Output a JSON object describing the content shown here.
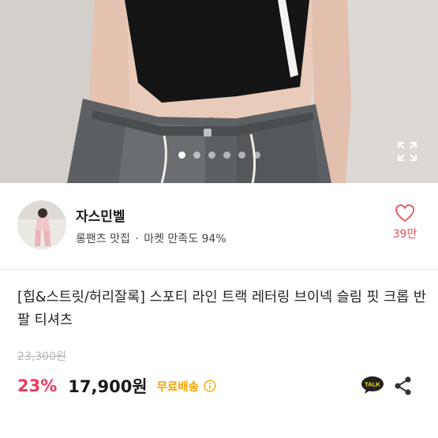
{
  "gallery": {
    "slide_count": 6,
    "active_slide": 1,
    "expand_icon": "expand-icon"
  },
  "seller": {
    "name": "자스민벨",
    "tagline": "롱팬츠 맛집",
    "separator": "·",
    "satisfaction": "마켓 만족도 94%",
    "likes": "39만",
    "heart_color": "#ef4f55"
  },
  "product": {
    "title": "[힙&스트릿/허리잘록] 스포티 라인 트랙 레터링 브이넥 슬림 핏 크롭 반팔 티셔츠",
    "original_price": "23,300원",
    "discount": "23%",
    "price": "17,900원",
    "shipping": "무료배송",
    "talk_label": "TALK",
    "discount_color": "#ef3a5d",
    "shipping_color": "#f5a300"
  }
}
